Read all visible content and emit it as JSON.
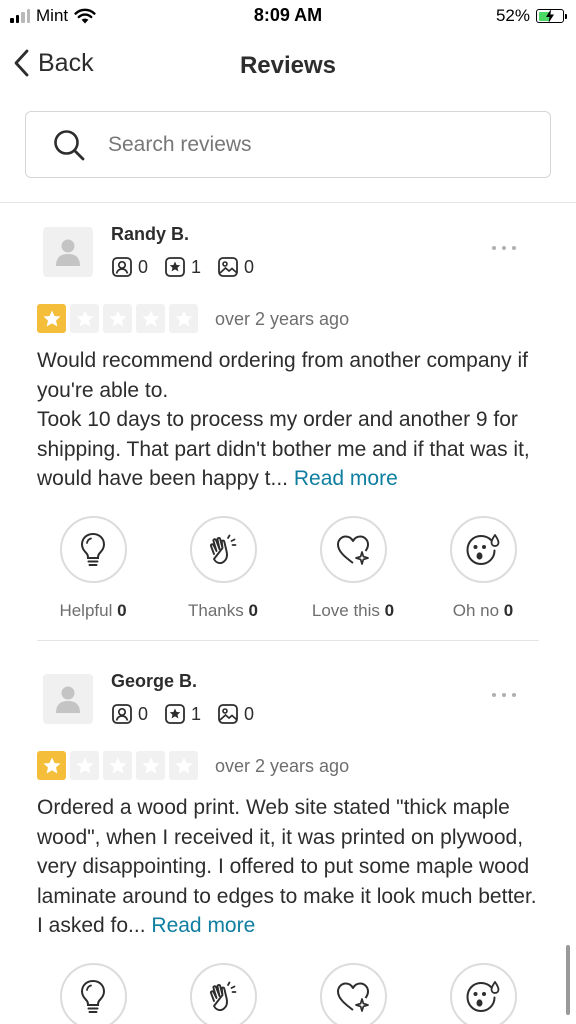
{
  "status_bar": {
    "carrier": "Mint",
    "time": "8:09 AM",
    "battery_percent": "52%",
    "battery_level": 0.52,
    "battery_color": "#4cd964",
    "icons": [
      "signal-icon",
      "wifi-icon",
      "battery-charging-icon"
    ]
  },
  "header": {
    "back_label": "Back",
    "title": "Reviews"
  },
  "search": {
    "placeholder": "Search reviews",
    "value": ""
  },
  "colors": {
    "accent_link": "#0f7ea0",
    "star_filled": "#f5be3a",
    "star_empty": "#f1f1f1"
  },
  "reviews": [
    {
      "name": "Randy B.",
      "friends_count": "0",
      "reviews_count": "1",
      "photos_count": "0",
      "rating": 1,
      "rating_max": 5,
      "date": "over 2 years ago",
      "text": "Would recommend ordering from another company if you're able to.\nTook 10 days to process my order and another 9 for shipping. That part didn't bother me and if that was it, would have been happy t...",
      "read_more": "Read more",
      "reactions": {
        "helpful_label": "Helpful",
        "helpful_count": "0",
        "thanks_label": "Thanks",
        "thanks_count": "0",
        "love_label": "Love this",
        "love_count": "0",
        "ohno_label": "Oh no",
        "ohno_count": "0"
      }
    },
    {
      "name": "George B.",
      "friends_count": "0",
      "reviews_count": "1",
      "photos_count": "0",
      "rating": 1,
      "rating_max": 5,
      "date": "over 2 years ago",
      "text": "Ordered a wood print. Web site stated \"thick maple wood\", when I received it, it was printed on plywood, very disappointing. I offered to put some maple wood laminate around to edges to make it look much better. I asked fo...",
      "read_more": "Read more"
    }
  ]
}
